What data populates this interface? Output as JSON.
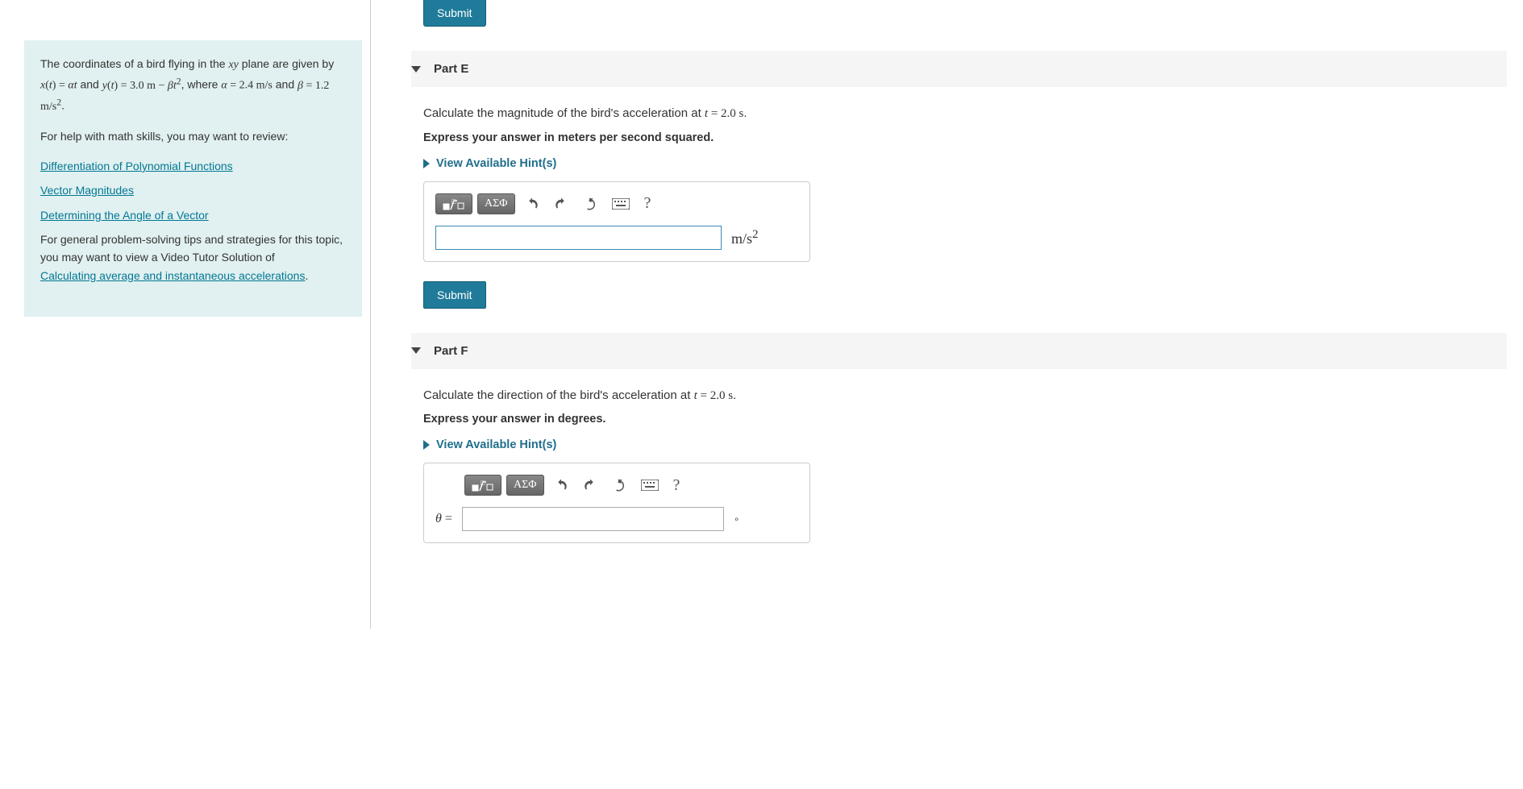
{
  "problem": {
    "intro_part1": "The coordinates of a bird flying in the ",
    "intro_plane": "xy",
    "intro_part2": " plane are given by ",
    "eq1": "x(t) = αt",
    "intro_and": " and ",
    "eq2": "y(t) = 3.0 m − βt²",
    "intro_where": ", where ",
    "eq3": "α = 2.4 m/s",
    "eq_and": " and ",
    "eq4": "β = 1.2 m/s²",
    "period": ".",
    "help_line": "For help with math skills, you may want to review:",
    "link1": "Differentiation of Polynomial Functions",
    "link2": "Vector Magnitudes",
    "link3": "Determining the Angle of a Vector",
    "general_part1": "For general problem-solving tips and strategies for this topic, you may want to view a Video Tutor Solution of ",
    "link4": "Calculating average and instantaneous accelerations",
    "general_period": "."
  },
  "buttons": {
    "submit": "Submit",
    "hints": "View Available Hint(s)"
  },
  "toolbar": {
    "greek": "ΑΣΦ",
    "help": "?"
  },
  "partE": {
    "title": "Part E",
    "q_part1": "Calculate the magnitude of the bird's acceleration at ",
    "q_time": "t = 2.0 s",
    "q_part2": ".",
    "instruction": "Express your answer in meters per second squared.",
    "unit": "m/s²"
  },
  "partF": {
    "title": "Part F",
    "q_part1": "Calculate the direction of the bird's acceleration at ",
    "q_time": "t = 2.0 s",
    "q_part2": ".",
    "instruction": "Express your answer in degrees.",
    "prefix": "θ",
    "eq": " = ",
    "unit": "∘"
  }
}
